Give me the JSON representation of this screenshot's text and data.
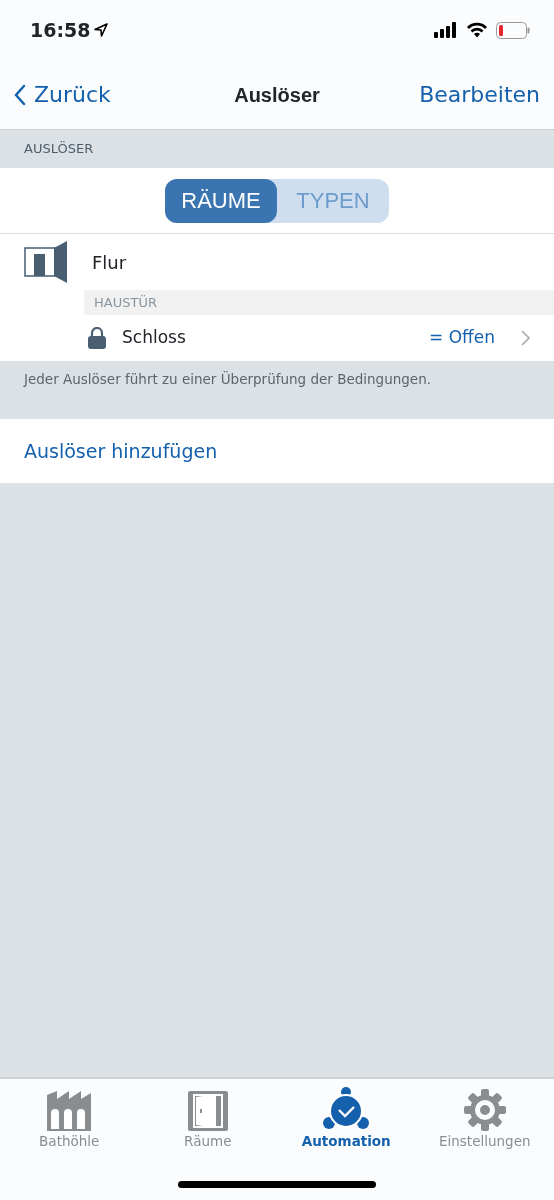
{
  "status_bar": {
    "time": "16:58"
  },
  "nav": {
    "back": "Zurück",
    "title": "Auslöser",
    "action": "Bearbeiten"
  },
  "section": {
    "header": "AUSLÖSER",
    "segments": [
      {
        "label": "RÄUME",
        "selected": true
      },
      {
        "label": "TYPEN",
        "selected": false
      }
    ],
    "room": {
      "name": "Flur",
      "device_header": "HAUSTÜR",
      "trigger": {
        "name": "Schloss",
        "value": "= Offen"
      }
    },
    "footer": "Jeder Auslöser führt zu einer Überprüfung der Bedingungen."
  },
  "add_action": "Auslöser hinzufügen",
  "tab_bar": [
    {
      "label": "Bathöhle",
      "kind": "factory",
      "selected": false
    },
    {
      "label": "Räume",
      "kind": "door",
      "selected": false
    },
    {
      "label": "Automation",
      "kind": "automation",
      "selected": true
    },
    {
      "label": "Einstellungen",
      "kind": "gear",
      "selected": false
    }
  ]
}
